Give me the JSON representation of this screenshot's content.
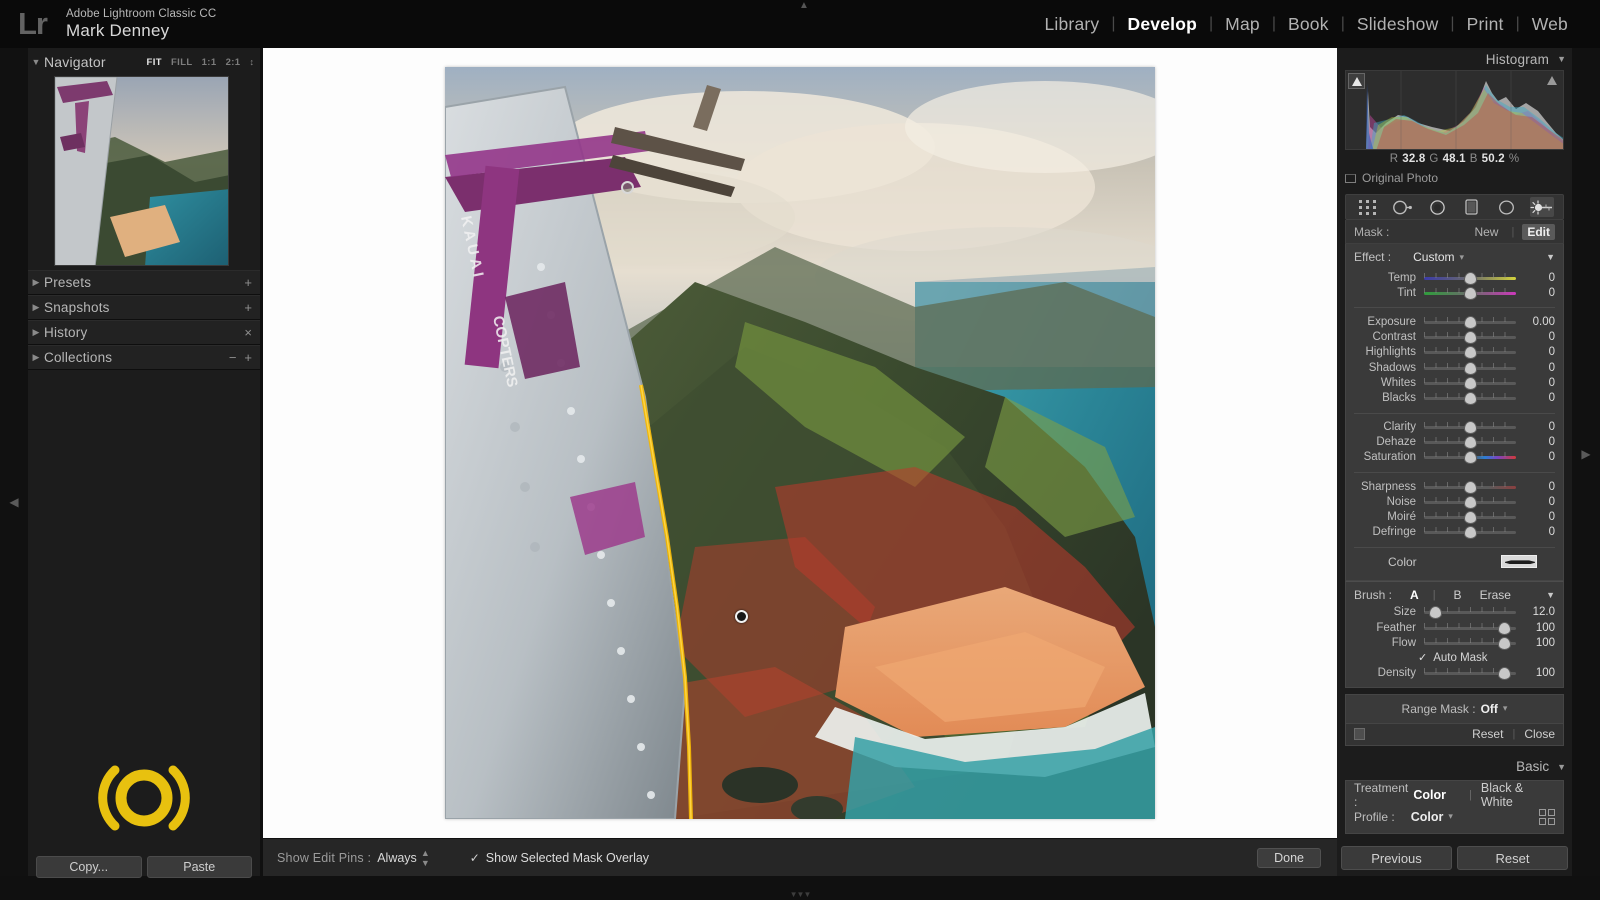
{
  "app": {
    "logo": "Lr",
    "name": "Adobe Lightroom Classic CC",
    "user": "Mark Denney"
  },
  "modules": [
    {
      "label": "Library",
      "active": false
    },
    {
      "label": "Develop",
      "active": true
    },
    {
      "label": "Map",
      "active": false
    },
    {
      "label": "Book",
      "active": false
    },
    {
      "label": "Slideshow",
      "active": false
    },
    {
      "label": "Print",
      "active": false
    },
    {
      "label": "Web",
      "active": false
    }
  ],
  "left": {
    "navigator": {
      "title": "Navigator",
      "zoom_levels": [
        {
          "label": "FIT",
          "active": true
        },
        {
          "label": "FILL",
          "active": false
        },
        {
          "label": "1:1",
          "active": false
        },
        {
          "label": "2:1",
          "active": false
        }
      ]
    },
    "sections": [
      {
        "label": "Presets",
        "actions": [
          "+"
        ]
      },
      {
        "label": "Snapshots",
        "actions": [
          "+"
        ]
      },
      {
        "label": "History",
        "actions": [
          "×"
        ]
      },
      {
        "label": "Collections",
        "actions": [
          "−",
          "+"
        ]
      }
    ],
    "buttons": {
      "copy": "Copy...",
      "paste": "Paste"
    }
  },
  "toolbar": {
    "show_edit_pins_label": "Show Edit Pins :",
    "show_edit_pins_value": "Always",
    "mask_overlay_label": "Show Selected Mask Overlay",
    "mask_overlay_checked": true,
    "done": "Done"
  },
  "right": {
    "histogram": {
      "title": "Histogram",
      "readout": {
        "r_label": "R",
        "r": "32.8",
        "g_label": "G",
        "g": "48.1",
        "b_label": "B",
        "b": "50.2",
        "unit": "%"
      },
      "original_photo": "Original Photo"
    },
    "tools": [
      {
        "name": "crop-overlay-tool",
        "active": false
      },
      {
        "name": "spot-removal-tool",
        "active": false
      },
      {
        "name": "red-eye-correction-tool",
        "active": false
      },
      {
        "name": "graduated-filter-tool",
        "active": false
      },
      {
        "name": "radial-filter-tool",
        "active": false
      },
      {
        "name": "adjustment-brush-tool",
        "active": true
      }
    ],
    "mask": {
      "label": "Mask :",
      "new_label": "New",
      "edit_label": "Edit",
      "active": "Edit"
    },
    "effect": {
      "label": "Effect :",
      "value": "Custom"
    },
    "slider_groups": [
      {
        "sliders": [
          {
            "name": "Temp",
            "value": "0",
            "pos": 50,
            "track": "grad-temp"
          },
          {
            "name": "Tint",
            "value": "0",
            "pos": 50,
            "track": "grad-tint"
          }
        ]
      },
      {
        "sliders": [
          {
            "name": "Exposure",
            "value": "0.00",
            "pos": 50,
            "track": ""
          },
          {
            "name": "Contrast",
            "value": "0",
            "pos": 50,
            "track": ""
          },
          {
            "name": "Highlights",
            "value": "0",
            "pos": 50,
            "track": ""
          },
          {
            "name": "Shadows",
            "value": "0",
            "pos": 50,
            "track": ""
          },
          {
            "name": "Whites",
            "value": "0",
            "pos": 50,
            "track": ""
          },
          {
            "name": "Blacks",
            "value": "0",
            "pos": 50,
            "track": ""
          }
        ]
      },
      {
        "sliders": [
          {
            "name": "Clarity",
            "value": "0",
            "pos": 50,
            "track": ""
          },
          {
            "name": "Dehaze",
            "value": "0",
            "pos": 50,
            "track": ""
          },
          {
            "name": "Saturation",
            "value": "0",
            "pos": 50,
            "track": "grad-sat"
          }
        ]
      },
      {
        "sliders": [
          {
            "name": "Sharpness",
            "value": "0",
            "pos": 50,
            "track": "grad-sharp"
          },
          {
            "name": "Noise",
            "value": "0",
            "pos": 50,
            "track": ""
          },
          {
            "name": "Moiré",
            "value": "0",
            "pos": 50,
            "track": ""
          },
          {
            "name": "Defringe",
            "value": "0",
            "pos": 50,
            "track": ""
          }
        ]
      }
    ],
    "color": {
      "label": "Color"
    },
    "brush": {
      "label": "Brush :",
      "options": [
        {
          "label": "A",
          "active": true
        },
        {
          "label": "B",
          "active": false
        },
        {
          "label": "Erase",
          "active": false
        }
      ],
      "sliders": [
        {
          "name": "Size",
          "value": "12.0",
          "pos": 13
        },
        {
          "name": "Feather",
          "value": "100",
          "pos": 88
        },
        {
          "name": "Flow",
          "value": "100",
          "pos": 88
        }
      ],
      "auto_mask_label": "Auto Mask",
      "auto_mask_checked": true,
      "density": {
        "name": "Density",
        "value": "100",
        "pos": 88
      }
    },
    "range_mask": {
      "label": "Range Mask :",
      "value": "Off"
    },
    "panel_footer": {
      "reset": "Reset",
      "close": "Close"
    },
    "basic": {
      "title": "Basic",
      "treatment_label": "Treatment :",
      "treatment_options": [
        {
          "label": "Color",
          "active": true
        },
        {
          "label": "Black & White",
          "active": false
        }
      ],
      "profile_label": "Profile :",
      "profile_value": "Color"
    },
    "buttons": {
      "previous": "Previous",
      "reset": "Reset"
    }
  },
  "photo": {
    "description": "Aerial view of Na Pali Coast cliffs and beach shot from a purple helicopter, with red mask overlay on cliff faces"
  }
}
